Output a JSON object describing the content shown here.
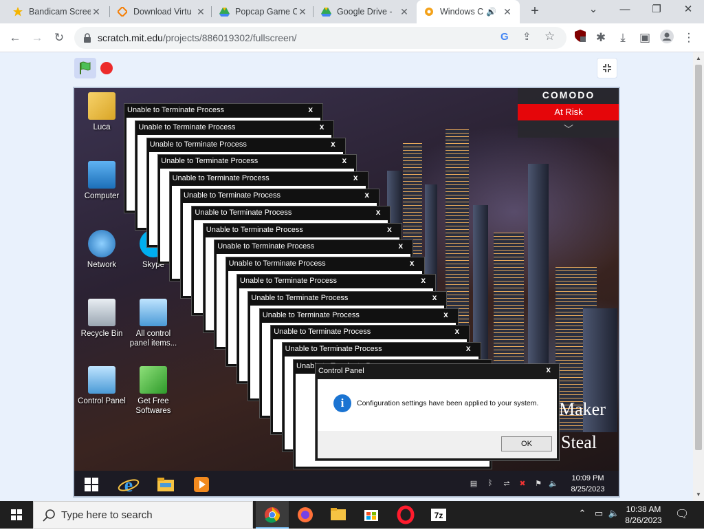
{
  "browser": {
    "tabs": [
      {
        "title": "Bandicam Scree",
        "icon": "star-icon",
        "color": "#f4b400"
      },
      {
        "title": "Download Virtu",
        "icon": "diamond-icon",
        "color": "#f57c00"
      },
      {
        "title": "Popcap Game C",
        "icon": "google-drive-icon",
        "color": "#34a853"
      },
      {
        "title": "Google Drive - ",
        "icon": "google-drive-icon",
        "color": "#34a853"
      },
      {
        "title": "Windows C",
        "icon": "scratch-icon",
        "color": "#f4a21a",
        "active": true
      }
    ],
    "url_host": "scratch.mit.edu",
    "url_path": "/projects/886019302/fullscreen/"
  },
  "vm": {
    "comodo": {
      "brand": "COMODO",
      "status": "At Risk",
      "status_color": "#e5060a"
    },
    "desktop_icons": [
      {
        "label": "Luca"
      },
      {
        "label": "Computer"
      },
      {
        "label": "Network"
      },
      {
        "label": "Skype"
      },
      {
        "label": "Recycle Bin"
      },
      {
        "label": "All control panel items..."
      },
      {
        "label": "Control Panel"
      },
      {
        "label": "Get Free Softwares"
      }
    ],
    "error_title": "Unable to Terminate Process",
    "error_close": "x",
    "dialog": {
      "title": "Control Panel",
      "close": "x",
      "message": "Configuration settings have been applied to your system.",
      "ok": "OK"
    },
    "overlay_text": [
      "Maker",
      "Steal"
    ],
    "clock": {
      "time": "10:09 PM",
      "date": "8/25/2023"
    }
  },
  "taskbar": {
    "search_placeholder": "Type here to search",
    "clock": {
      "time": "10:38 AM",
      "date": "8/26/2023"
    }
  }
}
